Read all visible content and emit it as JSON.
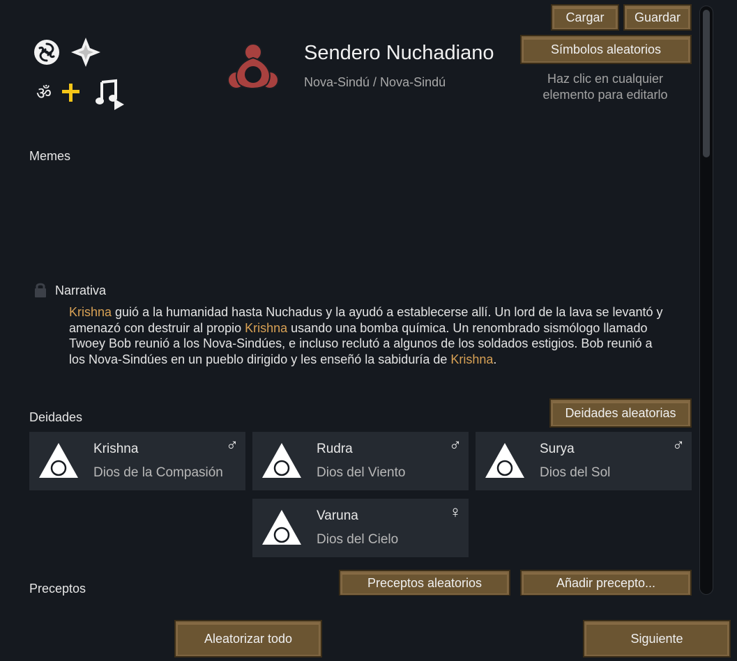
{
  "header": {
    "load_label": "Cargar",
    "save_label": "Guardar",
    "random_symbols_label": "Símbolos aleatorios",
    "ideo_name": "Sendero Nuchadiano",
    "culture": "Nova-Sindú / Nova-Sindú",
    "hint": "Haz clic en cualquier elemento para editarlo",
    "icon_color": "#a8413f"
  },
  "memes": {
    "label": "Memes"
  },
  "narrative": {
    "label": "Narrativa",
    "segments": [
      {
        "text": "Krishna",
        "highlight": true
      },
      {
        "text": " guió a la humanidad hasta Nuchadus y la ayudó a establecerse allí. Un lord de la lava se levantó y amenazó con destruir al propio ",
        "highlight": false
      },
      {
        "text": "Krishna",
        "highlight": true
      },
      {
        "text": " usando una bomba química. Un renombrado sismólogo llamado Twoey Bob reunió a los Nova-Sindúes, e incluso reclutó a algunos de los soldados estigios. Bob reunió a los Nova-Sindúes en un pueblo dirigido y les enseñó la sabiduría de ",
        "highlight": false
      },
      {
        "text": "Krishna",
        "highlight": true
      },
      {
        "text": ".",
        "highlight": false
      }
    ]
  },
  "deities": {
    "label": "Deidades",
    "random_label": "Deidades aleatorias",
    "items": [
      {
        "name": "Krishna",
        "title": "Dios de la Compasión",
        "gender": "♂"
      },
      {
        "name": "Rudra",
        "title": "Dios del Viento",
        "gender": "♂"
      },
      {
        "name": "Surya",
        "title": "Dios del Sol",
        "gender": "♂"
      },
      {
        "name": "Varuna",
        "title": "Dios del Cielo",
        "gender": "♀"
      }
    ]
  },
  "precepts": {
    "label": "Preceptos",
    "random_label": "Preceptos aleatorios",
    "add_label": "Añadir precepto..."
  },
  "footer": {
    "randomize_all_label": "Aleatorizar todo",
    "next_label": "Siguiente"
  },
  "colors": {
    "highlight": "#d8a155",
    "button_bg": "#6b5532",
    "panel_bg": "#15191f",
    "card_bg": "#252a31"
  }
}
